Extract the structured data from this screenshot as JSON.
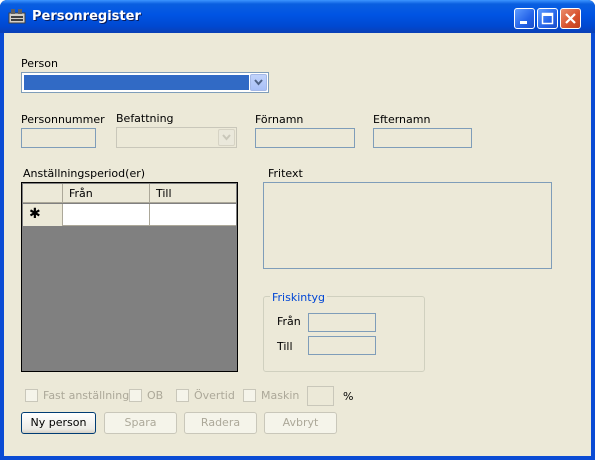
{
  "window": {
    "title": "Personregister"
  },
  "person": {
    "label": "Person"
  },
  "fields": {
    "personnummer": "Personnummer",
    "befattning": "Befattning",
    "fornamn": "Förnamn",
    "efternamn": "Efternamn"
  },
  "employment": {
    "label": "Anställningsperiod(er)",
    "columns": [
      "Från",
      "Till"
    ],
    "new_row_marker": "✱"
  },
  "fritext": {
    "label": "Fritext"
  },
  "friskintyg": {
    "title": "Friskintyg",
    "from_label": "Från",
    "to_label": "Till"
  },
  "options": {
    "fast": "Fast anställning",
    "ob": "OB",
    "overtid": "Övertid",
    "maskin": "Maskin",
    "percent": "%"
  },
  "buttons": {
    "ny_person": "Ny person",
    "spara": "Spara",
    "radera": "Radera",
    "avbryt": "Avbryt"
  },
  "colors": {
    "selection": "#316ac5",
    "client": "#ece9d8",
    "grid_bg": "#808080",
    "group_title": "#0046d5"
  }
}
